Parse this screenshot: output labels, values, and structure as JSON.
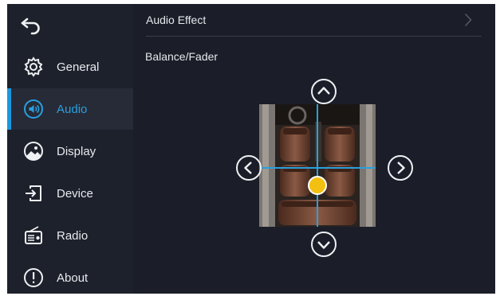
{
  "sidebar": {
    "back_icon": "back-arrow-icon",
    "items": [
      {
        "label": "General",
        "icon": "gear-icon",
        "active": false
      },
      {
        "label": "Audio",
        "icon": "speaker-icon",
        "active": true
      },
      {
        "label": "Display",
        "icon": "display-icon",
        "active": false
      },
      {
        "label": "Device",
        "icon": "device-icon",
        "active": false
      },
      {
        "label": "Radio",
        "icon": "radio-icon",
        "active": false
      },
      {
        "label": "About",
        "icon": "info-icon",
        "active": false
      }
    ]
  },
  "main": {
    "audio_effect": {
      "label": "Audio Effect",
      "icon": "chevron-right-icon"
    },
    "balance_fader": {
      "label": "Balance/Fader",
      "balance_position": 0,
      "fader_position": 0,
      "controls": [
        "chevron-up-icon",
        "chevron-down-icon",
        "chevron-left-icon",
        "chevron-right-icon"
      ]
    }
  },
  "colors": {
    "accent": "#1a97dd",
    "background": "#1b1e28",
    "sidebar": "#1d212b",
    "marker": "#f3c012"
  }
}
